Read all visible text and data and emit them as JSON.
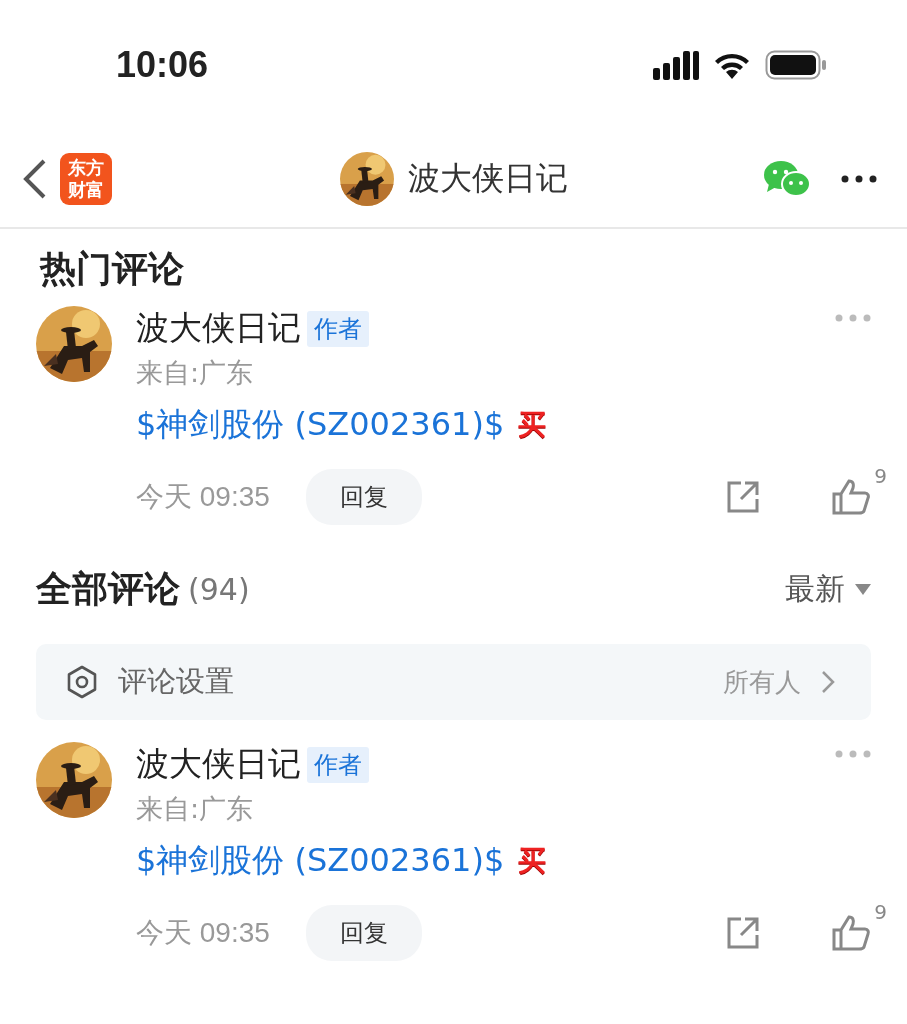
{
  "status_bar": {
    "time": "10:06"
  },
  "nav": {
    "logo": [
      "东方",
      "财富"
    ],
    "title": "波大侠日记"
  },
  "hot": {
    "title": "热门评论",
    "comments": [
      {
        "name": "波大侠日记",
        "badge": "作者",
        "location": "来自:广东",
        "stock": "$神剑股份 (SZ002361)$",
        "tag": "买",
        "time": "今天 09:35",
        "reply": "回复",
        "likes": "9"
      }
    ]
  },
  "all": {
    "title": "全部评论",
    "count": "(94)",
    "sort": "最新",
    "settings": {
      "label": "评论设置",
      "value": "所有人"
    },
    "comments": [
      {
        "name": "波大侠日记",
        "badge": "作者",
        "location": "来自:广东",
        "stock": "$神剑股份 (SZ002361)$",
        "tag": "买",
        "time": "今天 09:35",
        "reply": "回复",
        "likes": "9"
      }
    ]
  }
}
